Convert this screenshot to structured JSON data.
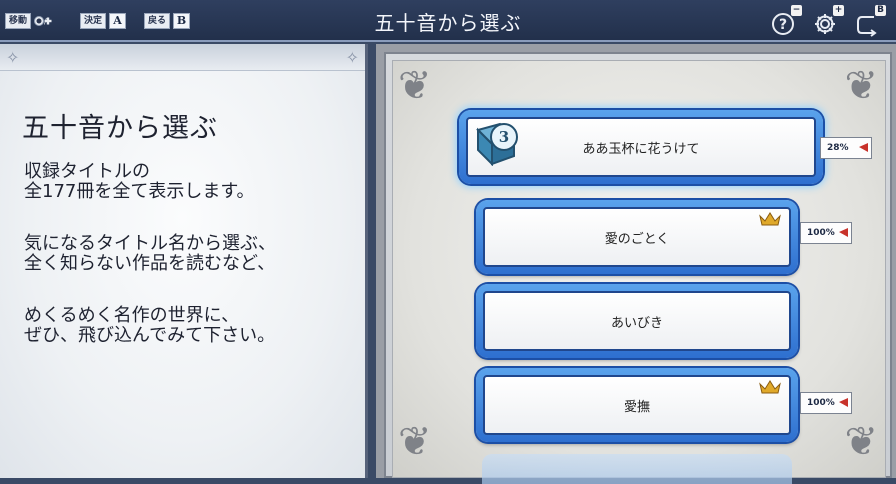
{
  "header": {
    "title": "五十音から選ぶ",
    "hints": [
      {
        "label": "移動",
        "key": "dpad"
      },
      {
        "label": "決定",
        "key": "A"
      },
      {
        "label": "戻る",
        "key": "B"
      }
    ],
    "icons": [
      {
        "name": "help-icon",
        "badge": "−"
      },
      {
        "name": "settings-icon",
        "badge": "+"
      },
      {
        "name": "back-icon",
        "badge": "B"
      }
    ]
  },
  "sidebar": {
    "heading": "五十音から選ぶ",
    "para1": "収録タイトルの\n全177冊を全て表示します。",
    "para2": "気になるタイトル名から選ぶ、\n全く知らない作品を読むなど、",
    "para3": "めくるめく名作の世界に、\nぜひ、飛び込んでみて下さい。"
  },
  "books": [
    {
      "title": "ああ玉杯に花うけて",
      "progress": "28%",
      "badge_number": "3",
      "crown": false,
      "selected": true
    },
    {
      "title": "愛のごとく",
      "progress": "100%",
      "crown": true,
      "selected": false
    },
    {
      "title": "あいびき",
      "progress": "",
      "crown": false,
      "selected": false
    },
    {
      "title": "愛撫",
      "progress": "100%",
      "crown": true,
      "selected": false
    }
  ],
  "colors": {
    "header_bg": "#22304b",
    "button_blue": "#2e6fcf",
    "selected_glow": "#8fd0ff",
    "flag_red": "#c8322a"
  }
}
